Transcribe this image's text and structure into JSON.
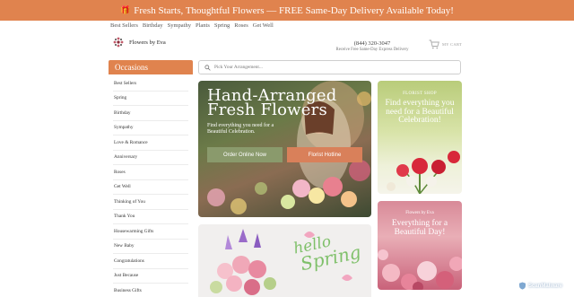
{
  "promo": {
    "icon": "gift-icon",
    "text": "Fresh Starts, Thoughtful Flowers — FREE Same-Day Delivery Available Today!"
  },
  "topnav": [
    "Best Sellers",
    "Birthday",
    "Sympathy",
    "Plants",
    "Spring",
    "Roses",
    "Get Well"
  ],
  "brand": {
    "name": "Flowers by Eva"
  },
  "contact": {
    "phone": "(844) 320-3047",
    "note": "Receive Free Same-Day Express Delivery"
  },
  "cart": {
    "label": "MY CART"
  },
  "sidebar": {
    "heading": "Occasions",
    "items": [
      "Best Sellers",
      "Spring",
      "Birthday",
      "Sympathy",
      "Love & Romance",
      "Anniversary",
      "Roses",
      "Get Well",
      "Thinking of You",
      "Thank You",
      "Housewarming Gifts",
      "New Baby",
      "Congratulations",
      "Just Because",
      "Business Gifts"
    ]
  },
  "search": {
    "placeholder": "Pick Your Arrangement..."
  },
  "hero": {
    "title_line1": "Hand-Arranged",
    "title_line2": "Fresh Flowers",
    "subtitle": "Find everything you need for a Beautiful Celebration.",
    "btn_primary": "Order Online Now",
    "btn_secondary": "Florist Hotline"
  },
  "promo_card_1": {
    "kicker": "FLORIST SHOP",
    "title": "Find everything you need for a Beautiful Celebration!"
  },
  "promo_card_2": {
    "kicker": "Flowers by Eva",
    "title": "Everything for a Beautiful Day!"
  },
  "spring_card": {
    "script_line1": "hello",
    "script_line2": "Spring"
  },
  "badge": {
    "text": "ScanMalware"
  },
  "colors": {
    "accent": "#e0834e",
    "green_button": "#8a9a6c",
    "orange_button": "#d9805a"
  }
}
